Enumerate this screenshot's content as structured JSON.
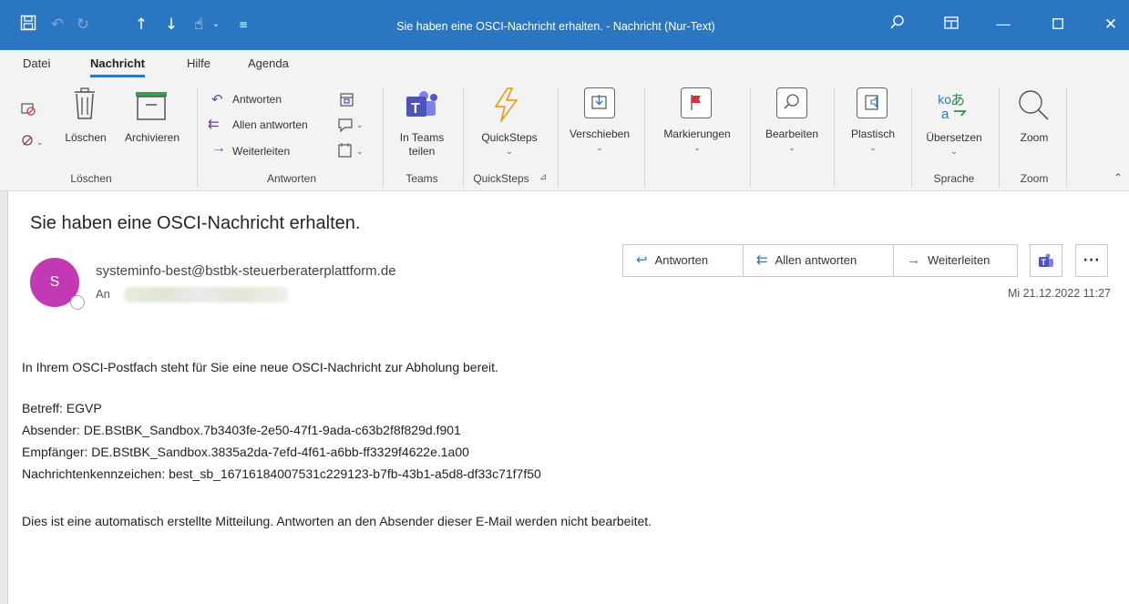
{
  "window": {
    "title": "Sie haben eine OSCI-Nachricht erhalten.  -  Nachricht (Nur-Text)"
  },
  "menu_tabs": [
    "Datei",
    "Nachricht",
    "Hilfe",
    "Agenda"
  ],
  "ribbon": {
    "loeschen": {
      "delete_label": "Löschen",
      "archive_label": "Archivieren",
      "group_label": "Löschen"
    },
    "antworten": {
      "reply": "Antworten",
      "reply_all": "Allen antworten",
      "forward": "Weiterleiten",
      "group_label": "Antworten"
    },
    "teams": {
      "button_line1": "In Teams",
      "button_line2": "teilen",
      "group_label": "Teams"
    },
    "quicksteps": {
      "button": "QuickSteps",
      "group_label": "QuickSteps"
    },
    "verschieben": "Verschieben",
    "markierungen": "Markierungen",
    "bearbeiten": "Bearbeiten",
    "plastisch": "Plastisch",
    "sprache": {
      "button": "Übersetzen",
      "group_label": "Sprache"
    },
    "zoom": {
      "button": "Zoom",
      "group_label": "Zoom"
    }
  },
  "message": {
    "subject": "Sie haben eine OSCI-Nachricht erhalten.",
    "avatar_initial": "S",
    "sender": "systeminfo-best@bstbk-steuerberaterplattform.de",
    "to_label": "An",
    "date": "Mi 21.12.2022 11:27",
    "actions": {
      "reply": "Antworten",
      "reply_all": "Allen antworten",
      "forward": "Weiterleiten"
    },
    "body": {
      "line1": "In Ihrem OSCI-Postfach steht für Sie eine neue OSCI-Nachricht zur Abholung bereit.",
      "betreff": "Betreff: EGVP",
      "absender": "Absender: DE.BStBK_Sandbox.7b3403fe-2e50-47f1-9ada-c63b2f8f829d.f901",
      "empfaenger": "Empfänger: DE.BStBK_Sandbox.3835a2da-7efd-4f61-a6bb-ff3329f4622e.1a00",
      "kennzeichen": "Nachrichtenkennzeichen: best_sb_16716184007531c229123-b7fb-43b1-a5d8-df33c71f7f50",
      "footer": "Dies ist eine automatisch erstellte Mitteilung. Antworten an den Absender dieser E-Mail werden nicht bearbeitet."
    }
  },
  "colors": {
    "titlebar": "#2b76c3",
    "avatar": "#c239b3",
    "accent": "#2b76c3"
  }
}
